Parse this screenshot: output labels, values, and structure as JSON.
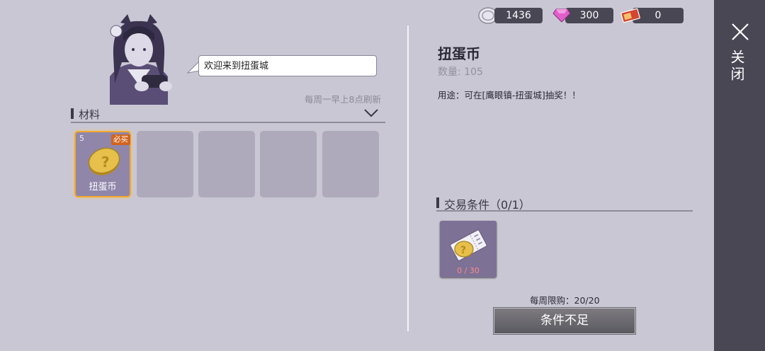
{
  "currencies": [
    {
      "icon": "silver-coin-icon",
      "value": "1436"
    },
    {
      "icon": "diamond-icon",
      "value": "300"
    },
    {
      "icon": "ticket-icon",
      "value": "0"
    }
  ],
  "npc": {
    "greeting": "欢迎来到扭蛋城",
    "refresh_note": "每周一早上8点刷新"
  },
  "materials": {
    "title": "材料",
    "slots": [
      {
        "count": "5",
        "badge": "必买",
        "label": "扭蛋币",
        "icon": "gacha-coin-icon"
      },
      {},
      {},
      {},
      {}
    ]
  },
  "detail": {
    "name": "扭蛋币",
    "quantity": "数量: 105",
    "usage": "用途：可在[鹰眼镇-扭蛋城]抽奖！！"
  },
  "trade": {
    "title": "交易条件（0/1）",
    "requirement": {
      "icon": "coin-ticket-icon",
      "count": "0 / 30"
    },
    "weekly_limit": "每周限购：20/20",
    "button_label": "条件不足"
  },
  "sidebar": {
    "close_label": "关闭"
  },
  "colors": {
    "background": "#c9c7d3",
    "panel_dark": "#4a4755",
    "selected_border": "#f0a92e",
    "must_buy_badge": "#d2641f",
    "insufficient_red": "#ff8a8a"
  }
}
